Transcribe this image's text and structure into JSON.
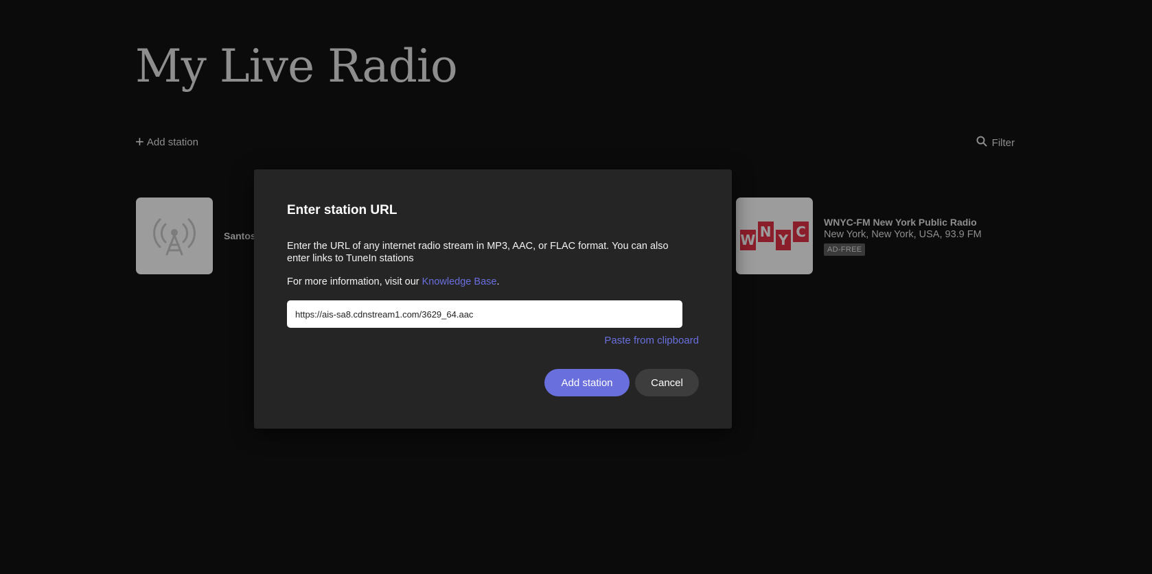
{
  "page": {
    "title": "My Live Radio"
  },
  "toolbar": {
    "add_label": "Add station",
    "filter_label": "Filter"
  },
  "stations": [
    {
      "name": "Santos",
      "icon": "radio-tower-icon"
    },
    {
      "name": "WNYC-FM New York Public Radio",
      "location": "New York, New York, USA, 93.9 FM",
      "badge": "AD-FREE",
      "logo_letters": [
        "W",
        "N",
        "Y",
        "C"
      ]
    }
  ],
  "modal": {
    "title": "Enter station URL",
    "description": "Enter the URL of any internet radio stream in MP3, AAC, or FLAC format. You can also enter links to TuneIn stations",
    "info_prefix": "For more information, visit our ",
    "info_link": "Knowledge Base",
    "info_suffix": ".",
    "url_value": "https://ais-sa8.cdnstream1.com/3629_64.aac",
    "paste_label": "Paste from clipboard",
    "add_button": "Add station",
    "cancel_button": "Cancel"
  },
  "colors": {
    "accent": "#6a6fde",
    "background": "#0b0b0b",
    "modal": "#252525",
    "wnyc_red": "#8b1e2b"
  }
}
